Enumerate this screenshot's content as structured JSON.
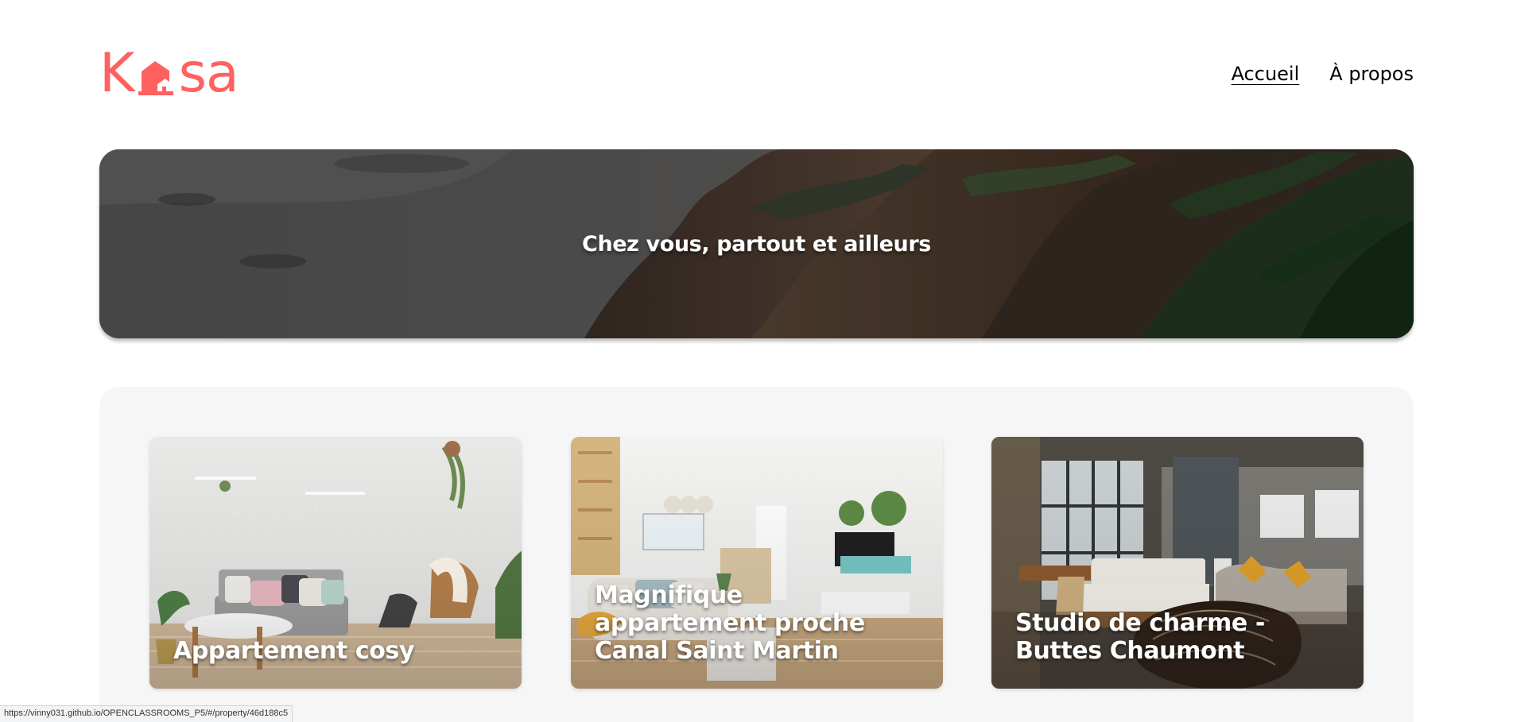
{
  "header": {
    "logo": {
      "left_text": "K",
      "right_text": "sa",
      "icon": "house-icon"
    },
    "nav": [
      {
        "label": "Accueil",
        "active": true
      },
      {
        "label": "À propos",
        "active": false
      }
    ]
  },
  "banner": {
    "title": "Chez vous, partout et ailleurs"
  },
  "gallery": {
    "cards": [
      {
        "title": "Appartement cosy"
      },
      {
        "title": "Magnifique appartement proche Canal Saint Martin"
      },
      {
        "title": "Studio de charme - Buttes Chaumont"
      }
    ]
  },
  "status_bar": {
    "url": "https://vinny031.github.io/OPENCLASSROOMS_P5/#/property/46d188c5"
  },
  "colors": {
    "brand": "#FF6060",
    "background": "#FFFFFF",
    "gallery_background": "#F6F6F6"
  }
}
